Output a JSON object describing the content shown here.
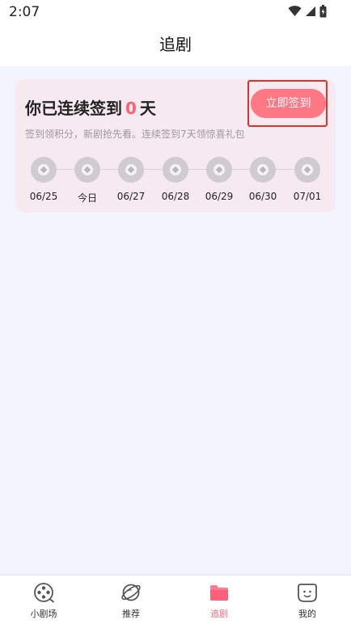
{
  "status_bar": {
    "time": "2:07"
  },
  "header": {
    "title": "追剧"
  },
  "checkin": {
    "heading_prefix": "你已连续签到",
    "streak_days": "0",
    "heading_suffix": "天",
    "description": "签到领积分，新剧抢先看。连续签到7天领惊喜礼包",
    "button_label": "立即签到",
    "accent_color": "#ff5f74",
    "days": [
      {
        "label": "06/25"
      },
      {
        "label": "今日"
      },
      {
        "label": "06/27"
      },
      {
        "label": "06/28"
      },
      {
        "label": "06/29"
      },
      {
        "label": "06/30"
      },
      {
        "label": "07/01"
      }
    ]
  },
  "bottom_nav": {
    "active_color": "#ff6b82",
    "items": [
      {
        "label": "小剧场",
        "icon": "film-reel-icon"
      },
      {
        "label": "推荐",
        "icon": "planet-icon"
      },
      {
        "label": "追剧",
        "icon": "folder-icon",
        "active": true
      },
      {
        "label": "我的",
        "icon": "profile-face-icon"
      }
    ]
  }
}
